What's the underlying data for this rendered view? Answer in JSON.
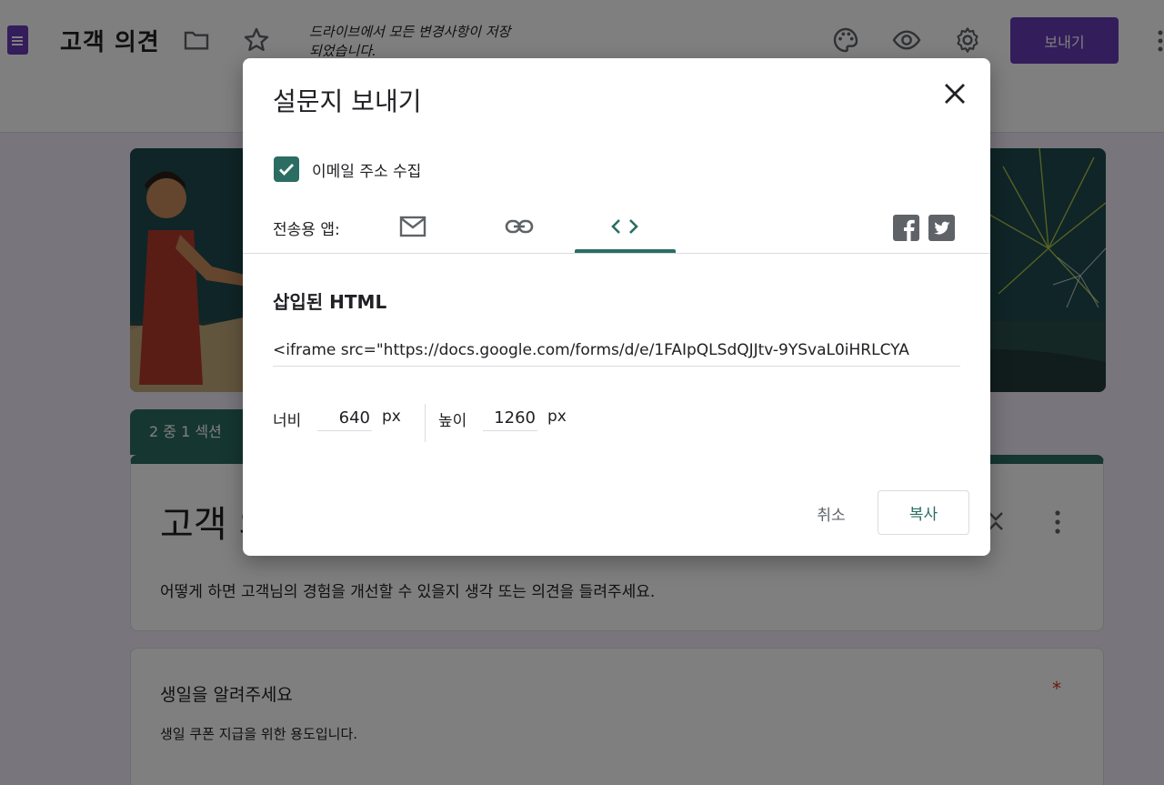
{
  "colors": {
    "brand": "#673ab7",
    "accent": "#2b6d63",
    "required": "#d93025"
  },
  "topbar": {
    "logo_icon": "forms-logo-icon",
    "title": "고객 의견",
    "folder_icon": "folder-icon",
    "star_icon": "star-icon",
    "save_status": "드라이브에서 모든 변경사항이 저장되었습니다.",
    "palette_icon": "palette-icon",
    "preview_icon": "eye-icon",
    "settings_icon": "gear-icon",
    "send_label": "보내기",
    "more_icon": "more-vert-icon"
  },
  "form": {
    "section_tab": "2 중 1 섹션",
    "title": "고객 의견",
    "description": "어떻게 하면 고객님의 경험을 개선할 수 있을지 생각 또는 의견을 들려주세요.",
    "question": {
      "title": "생일을 알려주세요",
      "required_mark": "*",
      "description": "생일 쿠폰 지급을 위한 용도입니다."
    }
  },
  "dialog": {
    "title": "설문지 보내기",
    "close_icon": "close-icon",
    "collect_email": {
      "label": "이메일 주소 수집",
      "checked": true
    },
    "send_via_label": "전송용 앱:",
    "tabs": [
      {
        "icon": "mail-icon",
        "selected": false
      },
      {
        "icon": "link-icon",
        "selected": false
      },
      {
        "icon": "embed-code-icon",
        "selected": true
      }
    ],
    "social": [
      {
        "icon": "facebook-icon"
      },
      {
        "icon": "twitter-icon"
      }
    ],
    "embed": {
      "heading": "삽입된 HTML",
      "code": "<iframe src=\"https://docs.google.com/forms/d/e/1FAIpQLSdQJJtv-9YSvaL0iHRLCYA",
      "width_label": "너비",
      "width_value": "640",
      "height_label": "높이",
      "height_value": "1260",
      "unit": "px"
    },
    "cancel_label": "취소",
    "copy_label": "복사"
  }
}
